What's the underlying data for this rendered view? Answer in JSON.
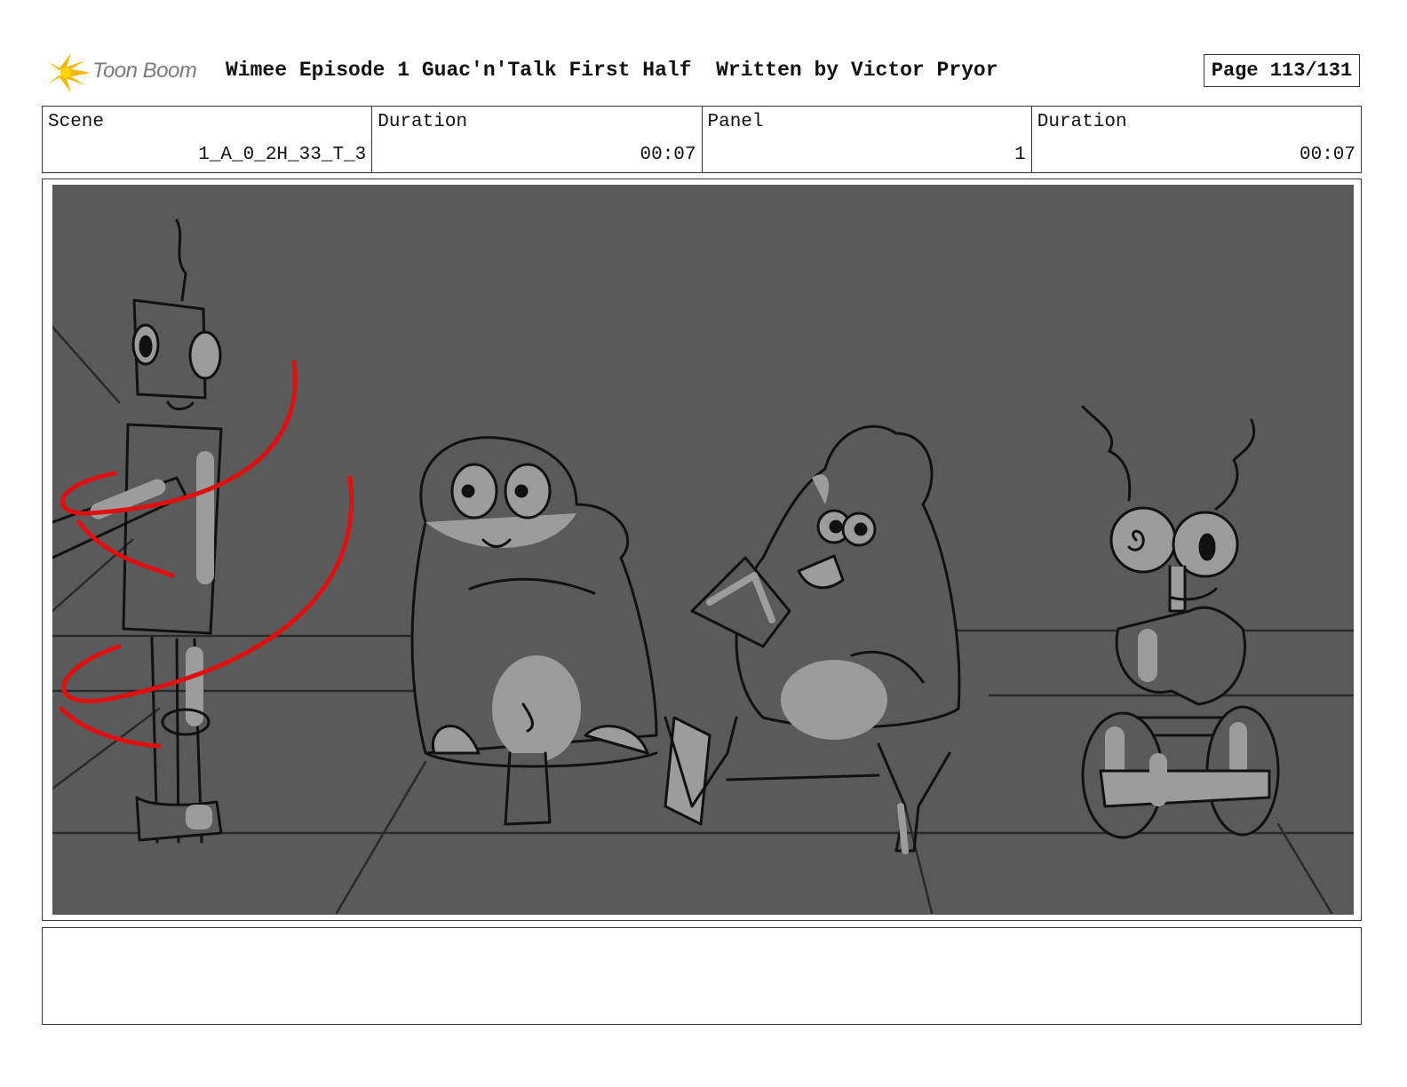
{
  "header": {
    "logo_text": "Toon Boom",
    "title": "Wimee Episode 1 Guac'n'Talk First Half  Written by Victor Pryor",
    "page": "Page 113/131"
  },
  "info": {
    "scene_label": "Scene",
    "scene_value": "1_A_0_2H_33_T_3",
    "duration_label": "Duration",
    "duration_value": "00:07",
    "panel_label": "Panel",
    "panel_value": "1",
    "panel_duration_label": "Duration",
    "panel_duration_value": "00:07"
  },
  "panel": {
    "description": ""
  },
  "colors": {
    "background": "#5a5a5a",
    "highlight": "#9c9c9c",
    "motion_lines": "#e01010",
    "ink": "#111111"
  }
}
